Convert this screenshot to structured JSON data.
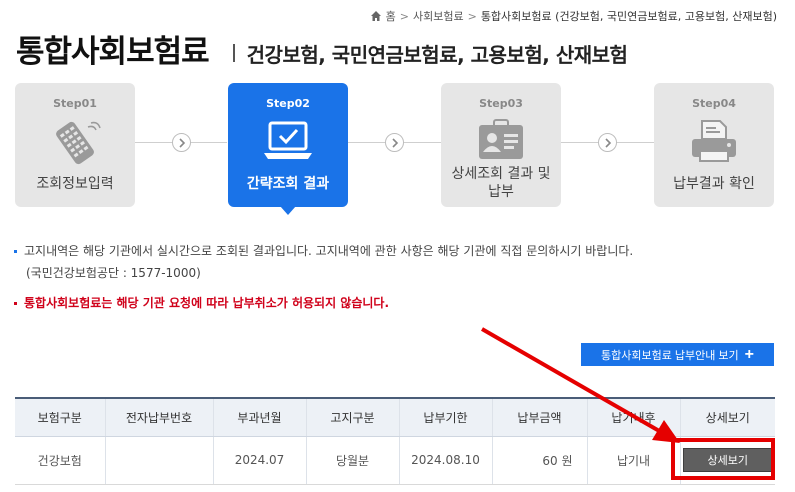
{
  "breadcrumb": {
    "home": "홈",
    "level1": "사회보험료",
    "current": "통합사회보험료 (건강보험, 국민연금보험료, 고용보험, 산재보험)"
  },
  "header": {
    "title": "통합사회보험료",
    "subtitle": "건강보험, 국민연금보험료, 고용보험, 산재보험"
  },
  "steps": [
    {
      "num": "Step01",
      "label": "조회정보입력",
      "icon": "remote-control-icon",
      "active": false
    },
    {
      "num": "Step02",
      "label": "간략조회 결과",
      "icon": "laptop-check-icon",
      "active": true
    },
    {
      "num": "Step03",
      "label": "상세조회 결과 및 납부",
      "icon": "id-card-icon",
      "active": false
    },
    {
      "num": "Step04",
      "label": "납부결과 확인",
      "icon": "printer-icon",
      "active": false
    }
  ],
  "notices": {
    "line1": "고지내역은 해당 기관에서 실시간으로 조회된 결과입니다. 고지내역에 관한 사항은 해당 기관에 직접 문의하시기 바랍니다.",
    "line1_sub": "(국민건강보험공단 : 1577-1000)",
    "warning": "통합사회보험료는 해당 기관 요청에 따라 납부취소가 허용되지 않습니다."
  },
  "guide_button": {
    "label": "통합사회보험료 납부안내 보기",
    "icon": "plus-icon"
  },
  "table": {
    "headers": [
      "보험구분",
      "전자납부번호",
      "부과년월",
      "고지구분",
      "납부기한",
      "납부금액",
      "납기내후",
      "상세보기"
    ],
    "rows": [
      {
        "type": "건강보험",
        "epay_no": "",
        "billing_month": "2024.07",
        "notice_type": "당월분",
        "due_date": "2024.08.10",
        "amount": "60 원",
        "period": "납기내",
        "detail_label": "상세보기"
      }
    ]
  },
  "colors": {
    "accent": "#1a73e8",
    "warning": "#d0021b",
    "highlight": "#e50000"
  }
}
